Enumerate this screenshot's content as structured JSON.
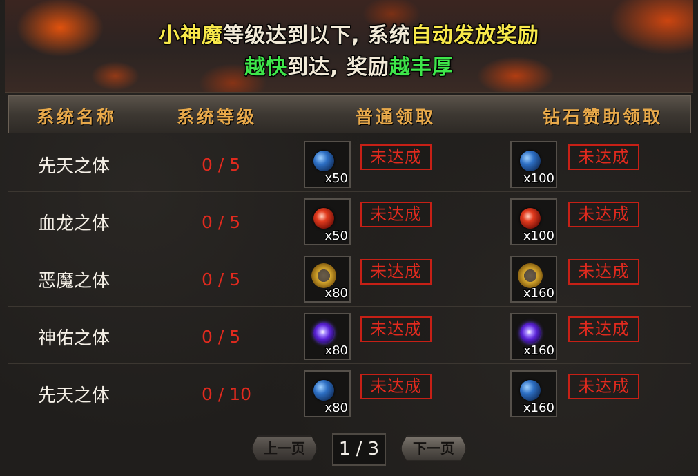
{
  "banner": {
    "line1": [
      {
        "text": "小神魔",
        "color": "yellow"
      },
      {
        "text": "等级达到以下, 系统",
        "color": "white"
      },
      {
        "text": "自动发放奖励",
        "color": "yellow"
      }
    ],
    "line2": [
      {
        "text": "越快",
        "color": "green"
      },
      {
        "text": "到达, 奖励",
        "color": "white"
      },
      {
        "text": "越丰厚",
        "color": "green"
      }
    ]
  },
  "table": {
    "headers": [
      "系统名称",
      "系统等级",
      "普通领取",
      "钻石赞助领取"
    ],
    "rows": [
      {
        "name": "先天之体",
        "progress": "0 / 5",
        "normal_icon": "blue-orb-icon",
        "normal_qty": "x50",
        "normal_status": "未达成",
        "diamond_icon": "blue-orb-icon",
        "diamond_qty": "x100",
        "diamond_status": "未达成"
      },
      {
        "name": "血龙之体",
        "progress": "0 / 5",
        "normal_icon": "red-orb-icon",
        "normal_qty": "x50",
        "normal_status": "未达成",
        "diamond_icon": "red-orb-icon",
        "diamond_qty": "x100",
        "diamond_status": "未达成"
      },
      {
        "name": "恶魔之体",
        "progress": "0 / 5",
        "normal_icon": "gold-emblem-icon",
        "normal_qty": "x80",
        "normal_status": "未达成",
        "diamond_icon": "gold-emblem-icon",
        "diamond_qty": "x160",
        "diamond_status": "未达成"
      },
      {
        "name": "神佑之体",
        "progress": "0 / 5",
        "normal_icon": "purple-orb-icon",
        "normal_qty": "x80",
        "normal_status": "未达成",
        "diamond_icon": "purple-orb-icon",
        "diamond_qty": "x160",
        "diamond_status": "未达成"
      },
      {
        "name": "先天之体",
        "progress": "0 / 10",
        "normal_icon": "blue-orb-icon",
        "normal_qty": "x80",
        "normal_status": "未达成",
        "diamond_icon": "blue-orb-icon",
        "diamond_qty": "x160",
        "diamond_status": "未达成"
      }
    ]
  },
  "pager": {
    "prev_label": "上一页",
    "next_label": "下一页",
    "page_indicator": "1 / 3"
  },
  "colors": {
    "yellow": "#f7e84a",
    "white": "#f2ead8",
    "green": "#3ee64a",
    "header_gold": "#e8a94a",
    "status_red": "#e02a1e"
  }
}
